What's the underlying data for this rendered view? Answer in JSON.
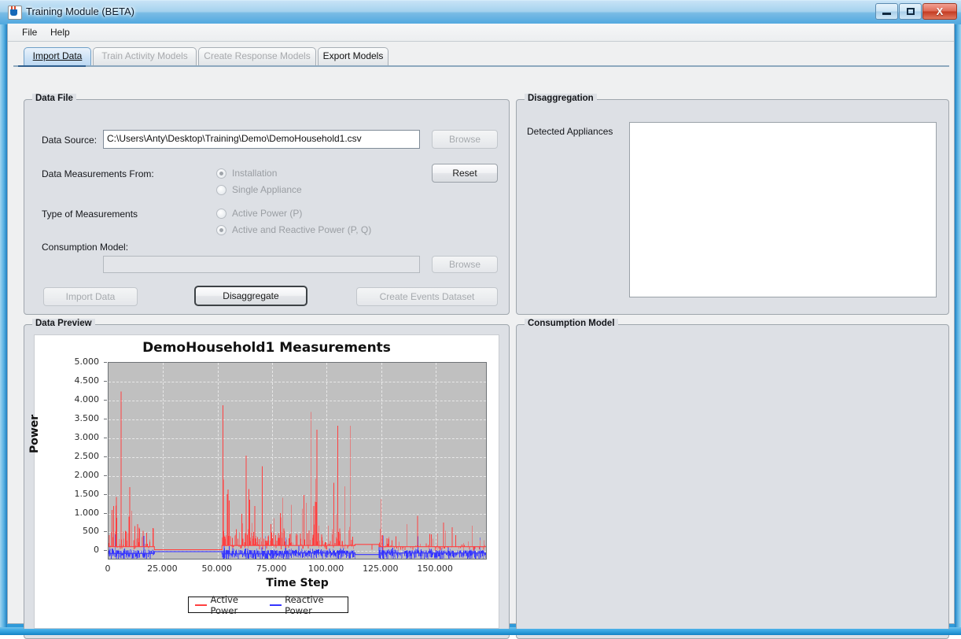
{
  "window": {
    "title": "Training Module (BETA)",
    "icon": "java-coffee-cup-icon",
    "minimize_label": "Minimize",
    "maximize_label": "Maximize",
    "close_label": "X"
  },
  "menubar": {
    "items": [
      {
        "label": "File"
      },
      {
        "label": "Help"
      }
    ]
  },
  "tabs": [
    {
      "label": "Import Data",
      "selected": true,
      "enabled": true
    },
    {
      "label": "Train Activity Models",
      "selected": false,
      "enabled": false
    },
    {
      "label": "Create Response Models",
      "selected": false,
      "enabled": false
    },
    {
      "label": "Export Models",
      "selected": false,
      "enabled": true
    }
  ],
  "data_file": {
    "group_title": "Data File",
    "data_source_label": "Data Source:",
    "data_source_value": "C:\\Users\\Anty\\Desktop\\Training\\Demo\\DemoHousehold1.csv",
    "browse_source_label": "Browse",
    "reset_label": "Reset",
    "measurements_from_label": "Data Measurements From:",
    "radio_installation": "Installation",
    "radio_single_appliance": "Single Appliance",
    "type_of_measurements_label": "Type of Measurements",
    "radio_active_power": "Active Power (P)",
    "radio_active_reactive_power": "Active and Reactive Power (P, Q)",
    "consumption_model_label": "Consumption Model:",
    "consumption_model_value": "",
    "browse_model_label": "Browse",
    "import_data_label": "Import Data",
    "disaggregate_label": "Disaggregate",
    "create_events_label": "Create Events Dataset"
  },
  "disaggregation": {
    "group_title": "Disaggregation",
    "detected_appliances_label": "Detected Appliances",
    "detected_appliances_items": []
  },
  "data_preview": {
    "group_title": "Data Preview"
  },
  "consumption_model": {
    "group_title": "Consumption Model",
    "content": ""
  },
  "chart_data": {
    "type": "line",
    "title": "DemoHousehold1 Measurements",
    "xlabel": "Time Step",
    "ylabel": "Power",
    "xlim": [
      0,
      173000
    ],
    "ylim": [
      -200,
      5000
    ],
    "grid": true,
    "legend_position": "bottom",
    "plot_background": "#c0c0c0",
    "x_ticks": [
      0,
      25000,
      50000,
      75000,
      100000,
      125000,
      150000
    ],
    "x_tick_labels": [
      "0",
      "25.000",
      "50.000",
      "75.000",
      "100.000",
      "125.000",
      "150.000"
    ],
    "y_ticks": [
      0,
      500,
      1000,
      1500,
      2000,
      2500,
      3000,
      3500,
      4000,
      4500,
      5000
    ],
    "y_tick_labels": [
      "0",
      "500",
      "1.000",
      "1.500",
      "2.000",
      "2.500",
      "3.000",
      "3.500",
      "4.000",
      "4.500",
      "5.000"
    ],
    "series": [
      {
        "name": "Active Power",
        "color": "#ff4040",
        "description": "Household aggregate active power, spiky load profile with four active periods separated by idle/baseline gaps.",
        "segments": [
          {
            "x_start": 0,
            "x_end": 21000,
            "baseline": 120,
            "peak_max": 4870,
            "peak_typical": 2800,
            "density": 0.55
          },
          {
            "x_start": 21000,
            "x_end": 52000,
            "baseline": 40,
            "peak_max": 40,
            "peak_typical": 40,
            "density": 0.0
          },
          {
            "x_start": 52000,
            "x_end": 84000,
            "baseline": 150,
            "peak_max": 4100,
            "peak_typical": 2500,
            "density": 0.7
          },
          {
            "x_start": 84000,
            "x_end": 113000,
            "baseline": 150,
            "peak_max": 3750,
            "peak_typical": 2200,
            "density": 0.65
          },
          {
            "x_start": 113000,
            "x_end": 124000,
            "baseline": 180,
            "peak_max": 220,
            "peak_typical": 190,
            "density": 0.02
          },
          {
            "x_start": 124000,
            "x_end": 173000,
            "baseline": 120,
            "peak_max": 1500,
            "peak_typical": 800,
            "density": 0.45
          }
        ]
      },
      {
        "name": "Reactive Power",
        "color": "#3636ff",
        "description": "Reactive power, near zero baseline with small oscillations and occasional spikes up to ~700.",
        "segments": [
          {
            "x_start": 0,
            "x_end": 21000,
            "baseline": -60,
            "peak_max": 480,
            "peak_typical": 120,
            "density": 0.5
          },
          {
            "x_start": 21000,
            "x_end": 52000,
            "baseline": -10,
            "peak_max": -10,
            "peak_typical": -10,
            "density": 0.0
          },
          {
            "x_start": 52000,
            "x_end": 84000,
            "baseline": -70,
            "peak_max": 400,
            "peak_typical": 120,
            "density": 0.6
          },
          {
            "x_start": 84000,
            "x_end": 113000,
            "baseline": -50,
            "peak_max": 700,
            "peak_typical": 130,
            "density": 0.6
          },
          {
            "x_start": 113000,
            "x_end": 124000,
            "baseline": -90,
            "peak_max": -80,
            "peak_typical": -85,
            "density": 0.0
          },
          {
            "x_start": 124000,
            "x_end": 173000,
            "baseline": -50,
            "peak_max": 420,
            "peak_typical": 110,
            "density": 0.5
          }
        ]
      }
    ],
    "legend": [
      {
        "label": "Active Power",
        "color": "#ff4040"
      },
      {
        "label": "Reactive Power",
        "color": "#3636ff"
      }
    ]
  }
}
